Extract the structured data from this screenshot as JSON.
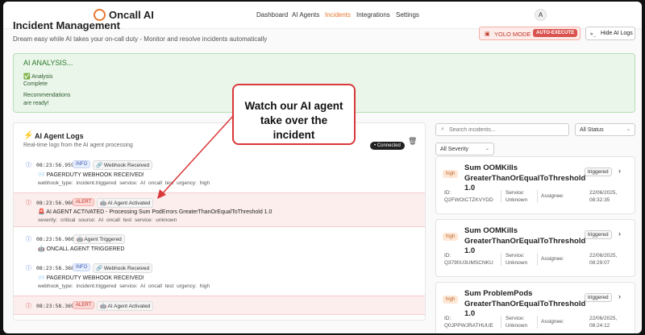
{
  "nav": {
    "brand": "Oncall AI",
    "links": [
      "Dashboard",
      "AI Agents",
      "Incidents",
      "Integrations",
      "Settings"
    ],
    "active": "Incidents",
    "avatar": "A"
  },
  "header": {
    "title": "Incident Management",
    "subtitle": "Dream easy while AI takes your on-call duty - Monitor and resolve incidents automatically",
    "yolo_label": "YOLO MODE",
    "yolo_badge": "AUTO-EXECUTE",
    "hide_logs_icon": ">_",
    "hide_logs_label": "Hide AI Logs"
  },
  "analysis": {
    "title": "AI ANALYSIS...",
    "line1": "✅ Analysis",
    "line2": "Complete",
    "line3": "Recommendations",
    "line4": "are ready!"
  },
  "logs": {
    "title": "AI Agent Logs",
    "subtitle": "Real-time logs from the AI agent processing",
    "connected": "• Connected",
    "entries": [
      {
        "type": "info",
        "icon": "ⓘ",
        "time": "08:23:56.959",
        "level": "INFO",
        "source": "🔗 Webhook Received",
        "message": "📨 PAGERDUTY WEBHOOK RECEIVED!",
        "details": "webhook_type: incident.triggered   service: AI oncall test   urgency: high"
      },
      {
        "type": "alert",
        "icon": "ⓘ",
        "time": "08:23:56.960",
        "level": "ALERT",
        "source": "🤖 AI Agent Activated",
        "message": "🚨 AI AGENT ACTIVATED - Processing Sum PodErrors GreaterThanOrEqualToThreshold 1.0",
        "details": "severity: critical   source: AI oncall test   service: unknown"
      },
      {
        "type": "plain",
        "icon": "ⓘ",
        "time": "08:23:56.960",
        "level": "",
        "source": "🤖 Agent Triggered",
        "message": "🤖 ONCALL AGENT TRIGGERED",
        "details": ""
      },
      {
        "type": "info",
        "icon": "ⓘ",
        "time": "08:23:58.368",
        "level": "INFO",
        "source": "🔗 Webhook Received",
        "message": "📨 PAGERDUTY WEBHOOK RECEIVED!",
        "details": "webhook_type: incident.triggered   service: AI oncall test   urgency: high"
      },
      {
        "type": "alert",
        "icon": "ⓘ",
        "time": "08:23:58.369",
        "level": "ALERT",
        "source": "🤖 AI Agent Activated",
        "message": "",
        "details": ""
      }
    ]
  },
  "incidents": {
    "search_placeholder": "Search incidents...",
    "status_filter": "All Status",
    "severity_filter": "All Severity",
    "cards": [
      {
        "severity": "high",
        "title": "Sum OOMKills GreaterThanOrEqualToThreshold 1.0",
        "status": "triggered",
        "id_label": "ID:",
        "id_value": "Q2FWOICTZKVYDD",
        "service_label": "Service:",
        "service_value": "Unknown",
        "assignee_label": "Assignee:",
        "date_value": "22/06/2025,",
        "time_value": "08:32:35"
      },
      {
        "severity": "high",
        "title": "Sum OOMKills GreaterThanOrEqualToThreshold 1.0",
        "status": "triggered",
        "id_label": "ID:",
        "id_value": "Q3790U3UMSCNKU",
        "service_label": "Service:",
        "service_value": "Unknown",
        "assignee_label": "Assignee:",
        "date_value": "22/06/2025,",
        "time_value": "08:29:07"
      },
      {
        "severity": "high",
        "title": "Sum ProblemPods GreaterThanOrEqualToThreshold 1.0",
        "status": "triggered",
        "id_label": "ID:",
        "id_value": "Q0JPPWJRATHUUE",
        "service_label": "Service:",
        "service_value": "Unknown",
        "assignee_label": "Assignee:",
        "date_value": "22/06/2025,",
        "time_value": "08:24:12"
      }
    ]
  },
  "callout": {
    "text_lines": [
      "Watch our AI agent",
      "take over the",
      "incident"
    ]
  },
  "colors": {
    "accent": "#e8772e",
    "alert": "#d9383a",
    "success": "#2b7a2b"
  }
}
